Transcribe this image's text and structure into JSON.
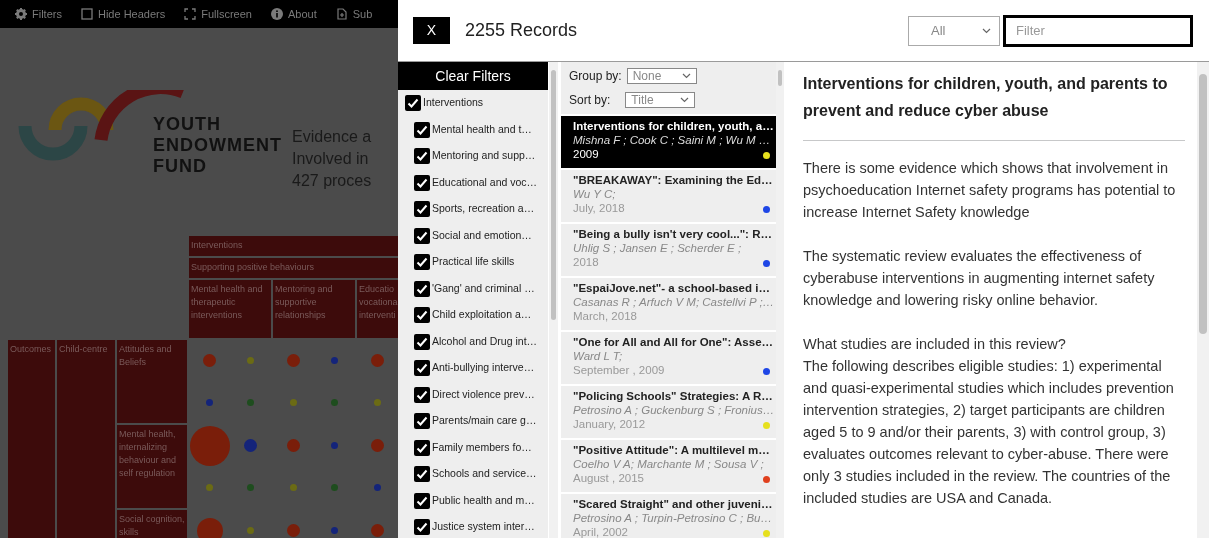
{
  "page": {
    "toolbar": [
      {
        "label": "Filters"
      },
      {
        "label": "Hide Headers"
      },
      {
        "label": "Fullscreen"
      },
      {
        "label": "About"
      },
      {
        "label": "Sub"
      }
    ],
    "logo": {
      "lines": [
        "YOUTH",
        "ENDOWMENT",
        "FUND"
      ]
    },
    "intro_lines": [
      "Evidence a",
      "Involved in",
      "427 proces"
    ],
    "matrix": {
      "header_1": "Interventions",
      "header_2": "Supporting positive behaviours",
      "columns": [
        "Mental health and therapeutic interventions",
        "Mentoring and supportive relationships",
        "Educatio vocationa interventi"
      ],
      "outcome_label": "Outcomes",
      "group_label": "Child-centre",
      "rows": [
        {
          "label": "Attitudes and Beliefs",
          "cells": [
            [
              {
                "color": "#7a1e0a",
                "kind": "medium"
              },
              {
                "color": "#6b6b14",
                "kind": "small"
              },
              {
                "color": "#14247a",
                "kind": "small"
              },
              {
                "color": "#1e4d1e",
                "kind": "small"
              }
            ],
            [
              {
                "color": "#7a1e0a",
                "kind": "medium"
              },
              {
                "color": "#14247a",
                "kind": "small"
              },
              {
                "color": "#6b6b14",
                "kind": "small"
              },
              {
                "color": "#1e4d1e",
                "kind": "small"
              }
            ],
            [
              {
                "color": "#7a1e0a",
                "kind": "medium"
              },
              {
                "color": "#6b6b14",
                "kind": "small"
              }
            ]
          ]
        },
        {
          "label": "Mental health, internalizing behaviour and self regulation",
          "cells": [
            [
              {
                "color": "#7a1e0a",
                "kind": "large"
              },
              {
                "color": "#14247a",
                "kind": "medium"
              },
              {
                "color": "#6b6b14",
                "kind": "small"
              },
              {
                "color": "#1e4d1e",
                "kind": "small"
              }
            ],
            [
              {
                "color": "#7a1e0a",
                "kind": "medium"
              },
              {
                "color": "#14247a",
                "kind": "small"
              },
              {
                "color": "#6b6b14",
                "kind": "small"
              },
              {
                "color": "#1e4d1e",
                "kind": "small"
              }
            ],
            [
              {
                "color": "#7a1e0a",
                "kind": "medium"
              },
              {
                "color": "#14247a",
                "kind": "small"
              }
            ]
          ]
        },
        {
          "label": "Social cognition, skills",
          "cells": [
            [
              {
                "color": "#7a1e0a",
                "kind": "big"
              },
              {
                "color": "#6b6b14",
                "kind": "small"
              }
            ],
            [
              {
                "color": "#7a1e0a",
                "kind": "medium"
              },
              {
                "color": "#14247a",
                "kind": "small"
              }
            ],
            [
              {
                "color": "#7a1e0a",
                "kind": "medium"
              }
            ]
          ]
        }
      ]
    }
  },
  "panel": {
    "close_label": "X",
    "record_count": "2255 Records",
    "scope_select": {
      "value": "All"
    },
    "filter_field": {
      "placeholder": "Filter"
    },
    "filters": {
      "clear_label": "Clear Filters",
      "items": [
        {
          "label": "Interventions",
          "checked": true,
          "children": [
            {
              "label": "Mental health and t…",
              "checked": true
            },
            {
              "label": "Mentoring and supp…",
              "checked": true
            },
            {
              "label": "Educational and voc…",
              "checked": true
            },
            {
              "label": "Sports, recreation a…",
              "checked": true
            },
            {
              "label": "Social and emotion…",
              "checked": true
            },
            {
              "label": "Practical life skills",
              "checked": true
            },
            {
              "label": "'Gang' and criminal …",
              "checked": true
            },
            {
              "label": "Child exploitation a…",
              "checked": true
            },
            {
              "label": "Alcohol and Drug int…",
              "checked": true
            },
            {
              "label": "Anti-bullying interve…",
              "checked": true
            },
            {
              "label": "Direct violence prev…",
              "checked": true
            },
            {
              "label": "Parents/main care g…",
              "checked": true
            },
            {
              "label": "Family members fo…",
              "checked": true
            },
            {
              "label": "Schools and service…",
              "checked": true
            },
            {
              "label": "Public health and m…",
              "checked": true
            },
            {
              "label": "Justice system inter…",
              "checked": true
            }
          ]
        }
      ]
    },
    "records": {
      "group_by": {
        "label": "Group by:",
        "value": "None"
      },
      "sort_by": {
        "label": "Sort by:",
        "value": "Title"
      },
      "items": [
        {
          "title": "Interventions for children, youth, a…",
          "authors": "Mishna F ; Cook C ; Saini M ; Wu M …",
          "date": "2009",
          "selected": true,
          "color": "#e6e01e"
        },
        {
          "title": "\"BREAKAWAY\": Examining the Ed…",
          "authors": "Wu Y C;",
          "date": "July, 2018",
          "selected": false,
          "color": "#1e46e6"
        },
        {
          "title": "\"Being a bully isn't very cool...\": R…",
          "authors": "Uhlig S ; Jansen E ; Scherder E ;",
          "date": "2018",
          "selected": false,
          "color": "#1e46e6"
        },
        {
          "title": "\"EspaiJove.net\"- a school-based i…",
          "authors": "Casanas R ; Arfuch V M; Castellvi P ;…",
          "date": "March, 2018",
          "selected": false
        },
        {
          "title": "\"One for All and All for One\": Asse…",
          "authors": "Ward L T;",
          "date": "September , 2009",
          "selected": false,
          "color": "#1e46e6"
        },
        {
          "title": "\"Policing Schools\" Strategies: A R…",
          "authors": "Petrosino A ; Guckenburg S ; Fronius…",
          "date": "January, 2012",
          "selected": false,
          "color": "#e6e01e"
        },
        {
          "title": "\"Positive Attitude\": A multilevel m…",
          "authors": "Coelho V A; Marchante M ; Sousa V ;",
          "date": "August , 2015",
          "selected": false,
          "color": "#e0401e"
        },
        {
          "title": "\"Scared Straight\" and other juveni…",
          "authors": "Petrosino A ; Turpin-Petrosino C ; Bu…",
          "date": "April, 2002",
          "selected": false,
          "color": "#e6e01e"
        }
      ]
    },
    "detail": {
      "title": "Interventions for children, youth, and parents to prevent and reduce cyber abuse",
      "paragraphs": [
        [
          "There is some evidence which shows that involvement in psychoeducation Internet safety programs has potential to increase Internet Safety knowledge"
        ],
        [
          "The systematic review evaluates the effectiveness of cyberabuse interventions in augmenting internet safety knowledge and lowering risky online behavior."
        ],
        [
          "What studies are included in this review?",
          "The following describes eligible studies: 1) experimental and quasi-experimental studies which includes prevention intervention strategies, 2) target participants are children aged 5 to 9 and/or their parents, 3) with control group, 3) evaluates outcomes relevant to cyber-abuse. There were only 3 studies included in the review. The countries of the included studies are USA and Canada."
        ]
      ]
    }
  }
}
